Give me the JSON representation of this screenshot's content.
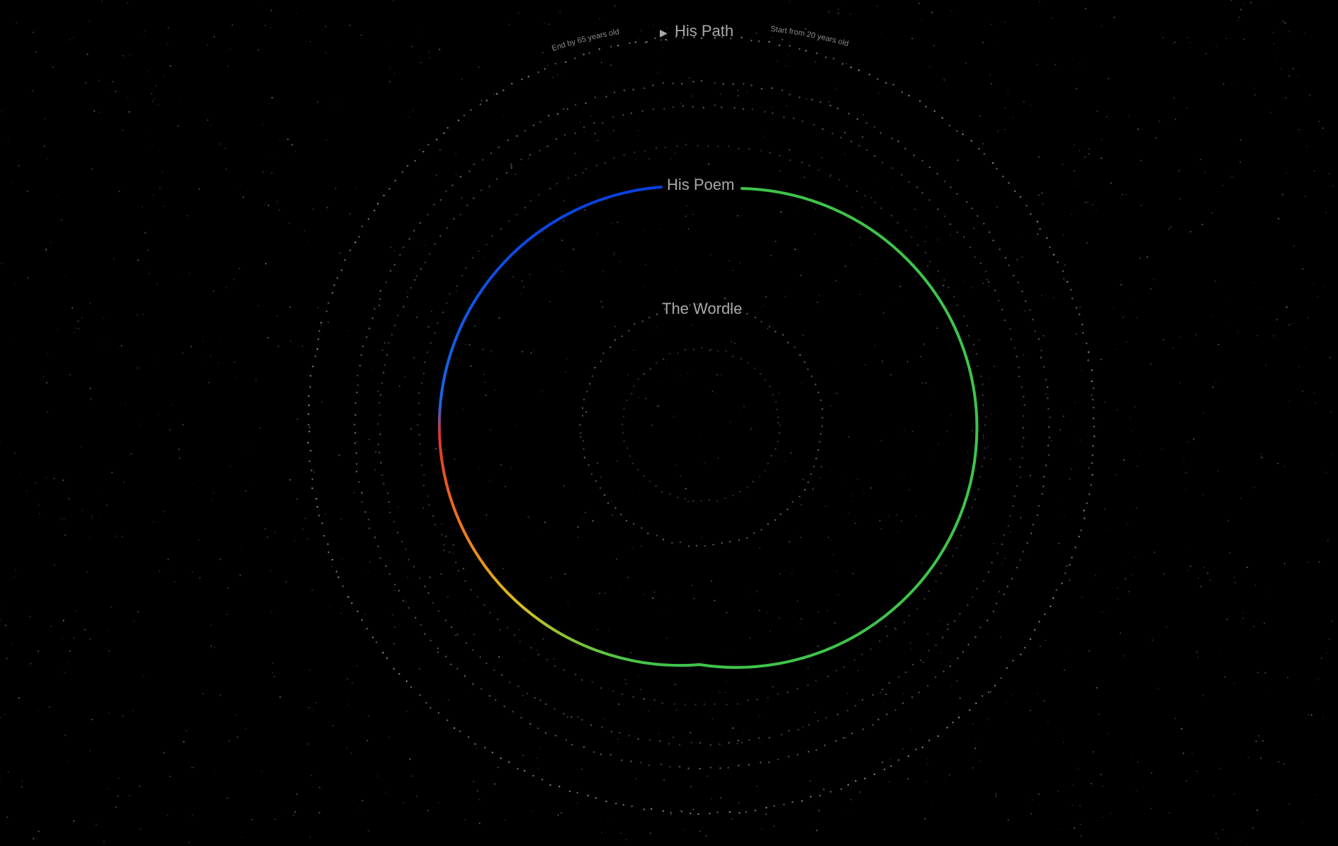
{
  "labels": {
    "path": "His Path",
    "poem": "His Poem",
    "wordle": "The Wordle",
    "end_age": "End by 65 years old",
    "start_age": "Start from 20 years old"
  },
  "controls": {
    "play_symbol": "▶"
  },
  "colors": {
    "background": "#000000",
    "label": "#a9a9a9",
    "dots": "#bdbdbd",
    "ring_green": "#3ec44b",
    "ring_yellow": "#d9c21a",
    "ring_orange": "#ef7a1a",
    "ring_red": "#e0342e",
    "ring_blue": "#1666e8",
    "ring_blue_dark": "#0a3fe0"
  }
}
